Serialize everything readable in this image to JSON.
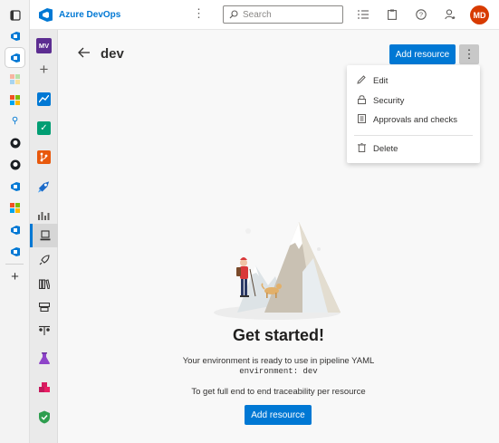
{
  "header": {
    "app_title": "Azure DevOps",
    "search_placeholder": "Search",
    "more_icon": "more-vertical-icon",
    "icons": [
      "task-list-icon",
      "clipboard-icon",
      "help-icon",
      "user-settings-icon"
    ],
    "avatar_initials": "MD"
  },
  "org_nav": {
    "project_initials": "MV"
  },
  "page": {
    "title": "dev",
    "add_resource_label": "Add resource"
  },
  "menu": {
    "items": [
      {
        "label": "Edit",
        "icon": "pencil-icon"
      },
      {
        "label": "Security",
        "icon": "lock-icon"
      },
      {
        "label": "Approvals and checks",
        "icon": "checklist-icon"
      },
      {
        "label": "Delete",
        "icon": "trash-icon"
      }
    ]
  },
  "empty_state": {
    "title": "Get started!",
    "line1": "Your environment is ready to use in pipeline YAML",
    "code": "environment: dev",
    "line2": "To get full end to end traceability per resource",
    "button_label": "Add resource"
  },
  "colors": {
    "accent": "#0078d4",
    "avatar": "#d83b01",
    "project_tile": "#5c2d91"
  }
}
